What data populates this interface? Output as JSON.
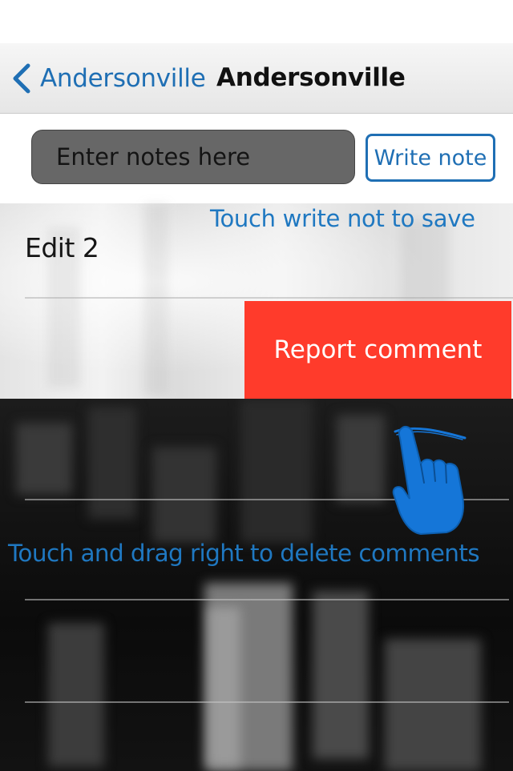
{
  "navbar": {
    "back_label": "Andersonville",
    "title": "Andersonville"
  },
  "notes": {
    "input_placeholder": "Enter notes here",
    "write_button_label": "Write note"
  },
  "comments": [
    {
      "text": "Edit 2"
    }
  ],
  "swipe_action": {
    "label": "Report comment",
    "color": "#ff3b2b"
  },
  "annotations": {
    "write_hint": "Touch write not to save",
    "drag_hint": "Touch and drag right to delete comments",
    "color": "#1f78c1"
  },
  "icons": {
    "back": "chevron-left-icon",
    "gesture": "hand-swipe-icon"
  },
  "accent_color": "#1f6fb4"
}
